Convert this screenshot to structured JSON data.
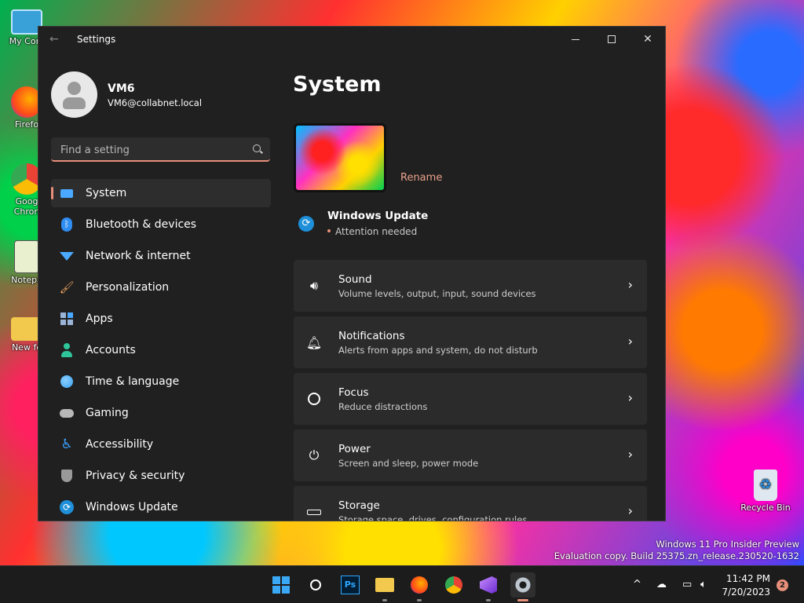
{
  "desktop": {
    "icons": [
      {
        "label": "My Com",
        "name": "my-computer"
      },
      {
        "label": "Firefo",
        "name": "firefox"
      },
      {
        "label": "Goog Chron",
        "name": "google-chrome"
      },
      {
        "label": "Notepa",
        "name": "notepad"
      },
      {
        "label": "New fo",
        "name": "new-folder"
      }
    ],
    "recycle_bin": "Recycle Bin",
    "watermark_line1": "Windows 11 Pro Insider Preview",
    "watermark_line2": "Evaluation copy. Build 25375.zn_release.230520-1632"
  },
  "window": {
    "title": "Settings",
    "profile": {
      "name": "VM6",
      "email": "VM6@collabnet.local"
    },
    "search_placeholder": "Find a setting",
    "nav": [
      {
        "label": "System",
        "icon": "monitor-icon",
        "color": "#4aa8ff",
        "selected": true
      },
      {
        "label": "Bluetooth & devices",
        "icon": "bluetooth-icon",
        "color": "#2f8cf0"
      },
      {
        "label": "Network & internet",
        "icon": "wifi-icon",
        "color": "#4aa8ff"
      },
      {
        "label": "Personalization",
        "icon": "brush-icon",
        "color": "#e8a060"
      },
      {
        "label": "Apps",
        "icon": "apps-icon",
        "color": "#9ab4d8"
      },
      {
        "label": "Accounts",
        "icon": "person-icon",
        "color": "#2fc59a"
      },
      {
        "label": "Time & language",
        "icon": "globe-clock-icon",
        "color": "#3aa0f0"
      },
      {
        "label": "Gaming",
        "icon": "gamepad-icon",
        "color": "#b8b8b8"
      },
      {
        "label": "Accessibility",
        "icon": "accessibility-icon",
        "color": "#3a9cf5"
      },
      {
        "label": "Privacy & security",
        "icon": "shield-icon",
        "color": "#9a9a9a"
      },
      {
        "label": "Windows Update",
        "icon": "update-icon",
        "color": "#1e8fd8"
      }
    ],
    "page_title": "System",
    "rename_label": "Rename",
    "windows_update": {
      "title": "Windows Update",
      "status": "Attention needed"
    },
    "cards": [
      {
        "title": "Sound",
        "subtitle": "Volume levels, output, input, sound devices",
        "icon": "speaker-icon"
      },
      {
        "title": "Notifications",
        "subtitle": "Alerts from apps and system, do not disturb",
        "icon": "bell-icon"
      },
      {
        "title": "Focus",
        "subtitle": "Reduce distractions",
        "icon": "focus-icon"
      },
      {
        "title": "Power",
        "subtitle": "Screen and sleep, power mode",
        "icon": "power-icon"
      },
      {
        "title": "Storage",
        "subtitle": "Storage space, drives, configuration rules",
        "icon": "storage-icon"
      }
    ]
  },
  "taskbar": {
    "apps": [
      "start",
      "search",
      "photoshop",
      "file-explorer",
      "firefox",
      "chrome",
      "visual-studio",
      "settings"
    ],
    "photoshop_label": "Ps",
    "time": "11:42 PM",
    "date": "7/20/2023",
    "notification_count": "2"
  },
  "colors": {
    "accent": "#e88f7a",
    "window_bg": "#202020",
    "card_bg": "#2b2b2b"
  }
}
